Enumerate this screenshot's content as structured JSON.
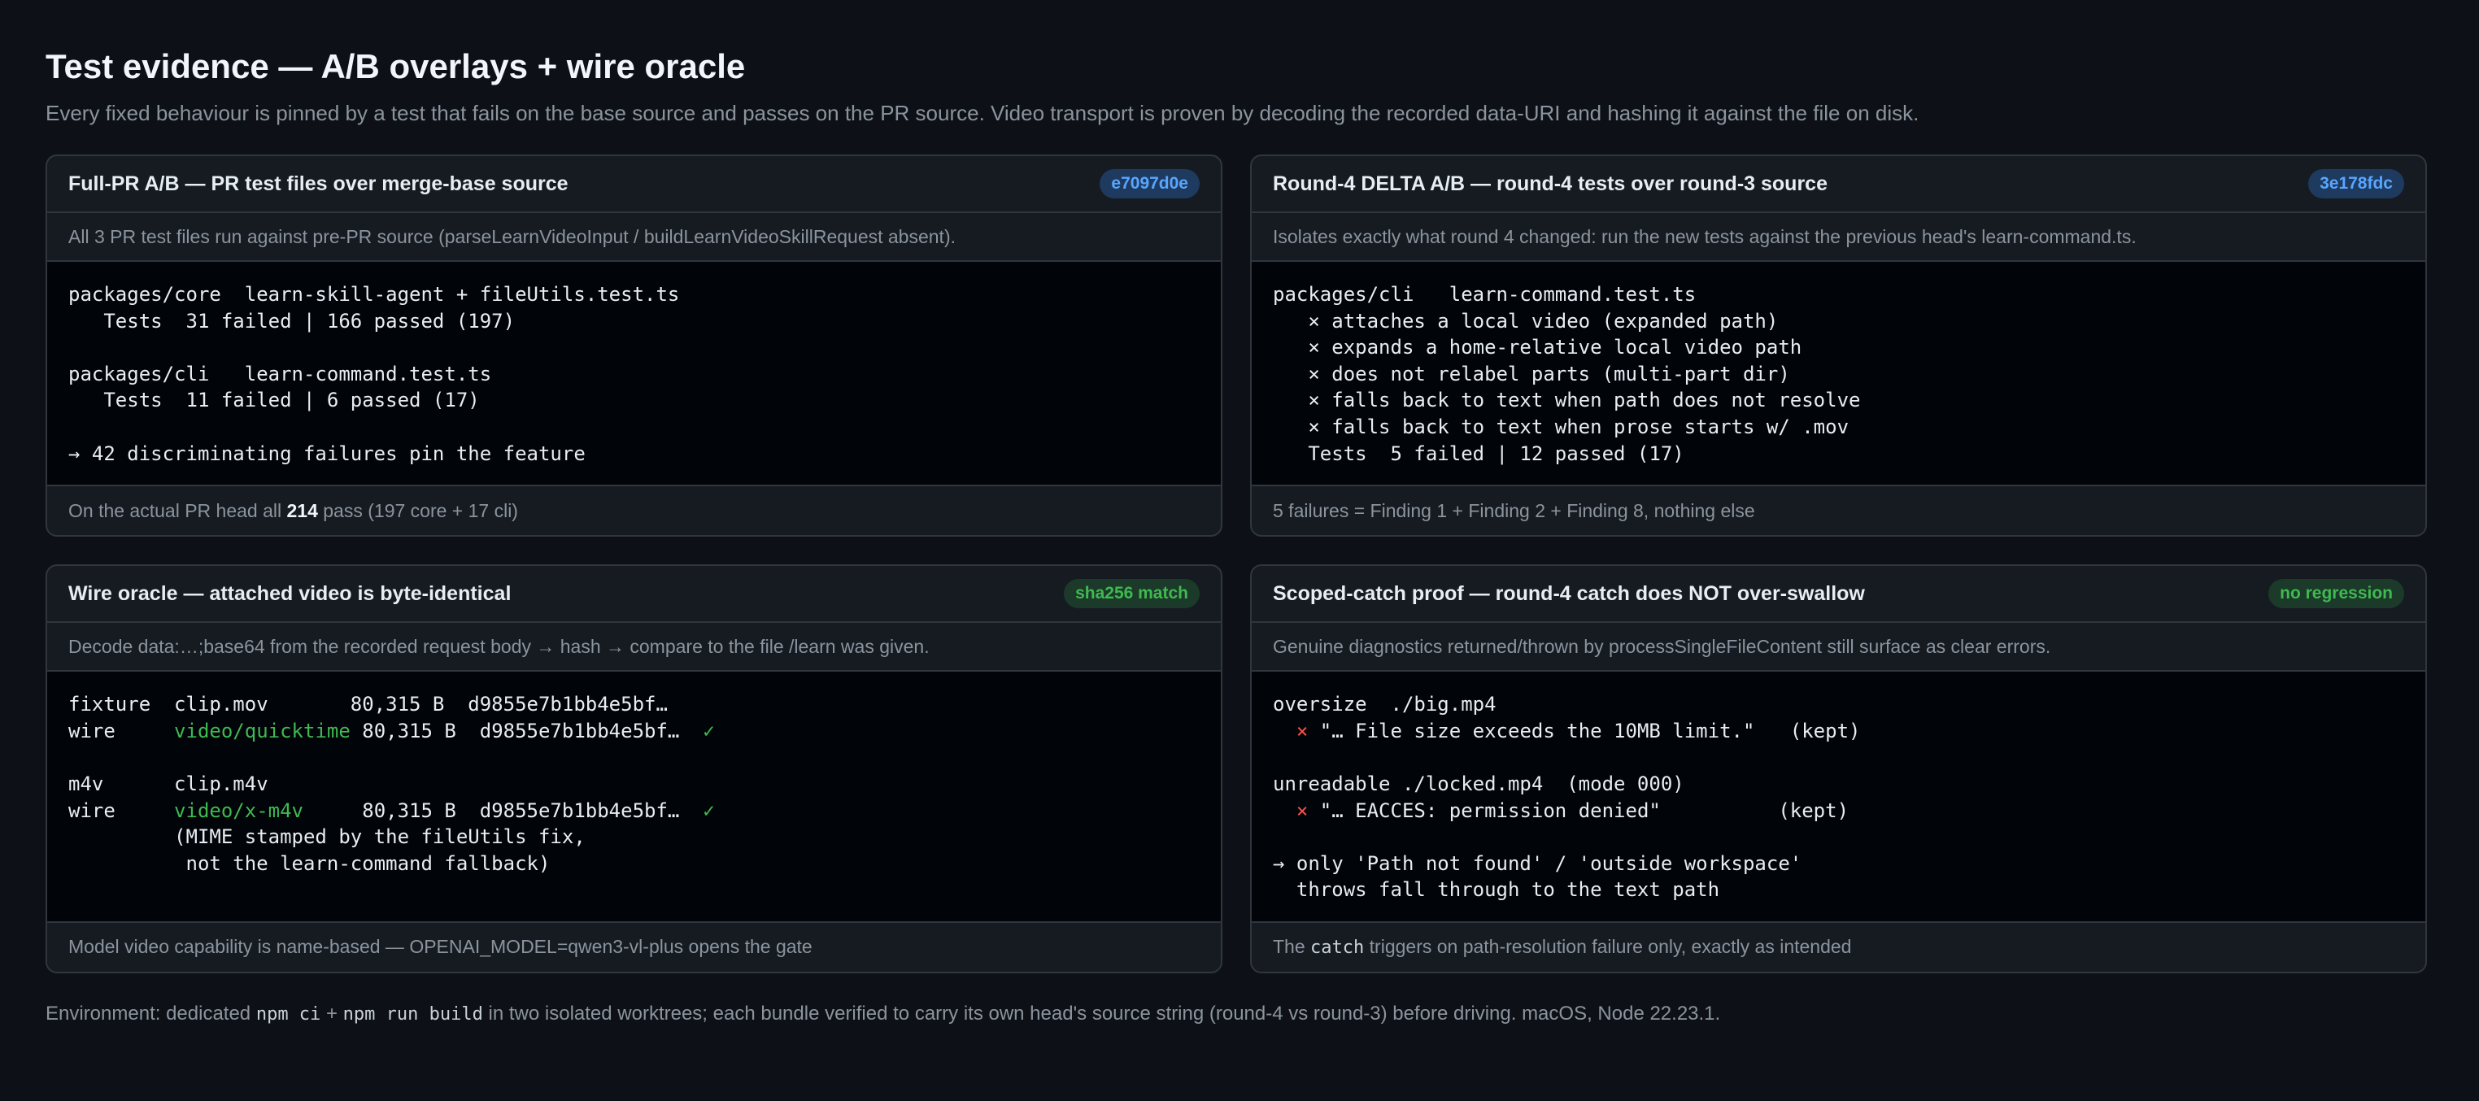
{
  "page": {
    "title": "Test evidence — A/B overlays + wire oracle",
    "subtitle": "Every fixed behaviour is pinned by a test that fails on the base source and passes on the PR source. Video transport is proven by decoding the recorded data-URI and hashing it against the file on disk."
  },
  "cards": {
    "full_pr": {
      "title": "Full-PR A/B — PR test files over merge-base source",
      "badge": "e7097d0e",
      "desc": "All 3 PR test files run against pre-PR source (parseLearnVideoInput / buildLearnVideoSkillRequest absent).",
      "lines": [
        "packages/core  learn-skill-agent + fileUtils.test.ts",
        "   Tests  31 failed | 166 passed (197)",
        "packages/cli   learn-command.test.ts",
        "   Tests  11 failed | 6 passed (17)",
        "→ 42 discriminating failures pin the feature"
      ],
      "foot_pre": "On the actual PR head all ",
      "foot_bold": "214",
      "foot_post": " pass (197 core + 17 cli)"
    },
    "round4": {
      "title": "Round-4 DELTA A/B — round-4 tests over round-3 source",
      "badge": "3e178fdc",
      "desc": "Isolates exactly what round 4 changed: run the new tests against the previous head's learn-command.ts.",
      "lines": [
        "packages/cli   learn-command.test.ts",
        "   × attaches a local video (expanded path)",
        "   × expands a home-relative local video path",
        "   × does not relabel parts (multi-part dir)",
        "   × falls back to text when path does not resolve",
        "   × falls back to text when prose starts w/ .mov",
        "   Tests  5 failed | 12 passed (17)"
      ],
      "foot": "5 failures = Finding 1 + Finding 2 + Finding 8, nothing else"
    },
    "wire": {
      "title": "Wire oracle — attached video is byte-identical",
      "badge": "sha256 match",
      "desc": "Decode data:…;base64 from the recorded request body → hash → compare to the file /learn was given.",
      "l1_a": "fixture  clip.mov       80,315 B  d9855e7b1bb4e5bf…",
      "l2_a": "wire     ",
      "l2_b": "video/quicktime",
      "l2_c": " 80,315 B  d9855e7b1bb4e5bf…  ",
      "l2_d": "✓",
      "l3_a": "m4v      clip.m4v",
      "l4_a": "wire     ",
      "l4_b": "video/x-m4v",
      "l4_c": "     80,315 B  d9855e7b1bb4e5bf…  ",
      "l4_d": "✓",
      "l5": "         (MIME stamped by the fileUtils fix,",
      "l6": "          not the learn-command fallback)",
      "foot": "Model video capability is name-based — OPENAI_MODEL=qwen3-vl-plus opens the gate"
    },
    "scoped": {
      "title": "Scoped-catch proof — round-4 catch does NOT over-swallow",
      "badge": "no regression",
      "desc": "Genuine diagnostics returned/thrown by processSingleFileContent still surface as clear errors.",
      "l1": "oversize  ./big.mp4",
      "l2_a": "  ",
      "l2_b": "×",
      "l2_c": " \"… File size exceeds the 10MB limit.\"   (kept)",
      "l3": "unreadable ./locked.mp4  (mode 000)",
      "l4_a": "  ",
      "l4_b": "×",
      "l4_c": " \"… EACCES: permission denied\"          (kept)",
      "l5": "→ only 'Path not found' / 'outside workspace'",
      "l6": "  throws fall through to the text path",
      "foot_pre": "The ",
      "foot_code": "catch",
      "foot_post": " triggers on path-resolution failure only, exactly as intended"
    }
  },
  "env": {
    "pre": "Environment: dedicated ",
    "code1": "npm ci",
    "mid1": " + ",
    "code2": "npm run build",
    "post": " in two isolated worktrees; each bundle verified to carry its own head's source string (round-4 vs round-3) before driving. macOS, Node 22.23.1."
  },
  "colors": {
    "background": "#0d1117",
    "card": "#161b22",
    "terminal": "#010409",
    "border": "#30363d",
    "accent_blue": "#58a6ff",
    "accent_green": "#3fb950",
    "error_red": "#f85149"
  }
}
